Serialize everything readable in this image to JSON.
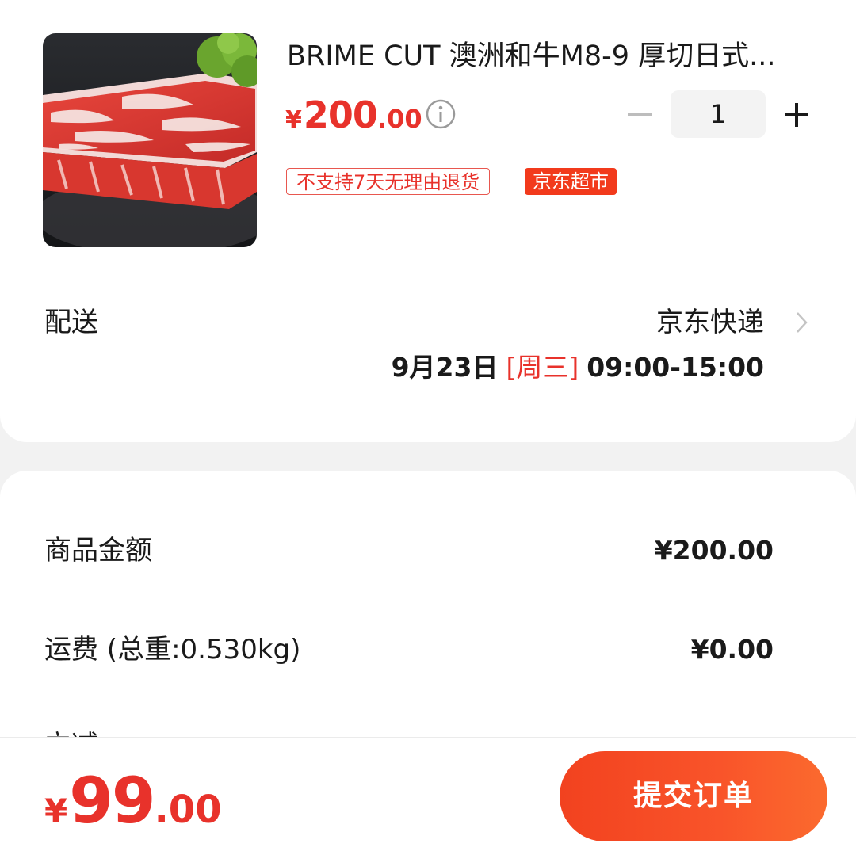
{
  "product": {
    "title": "BRIME CUT 澳洲和牛M8-9 厚切日式...",
    "image": "wagyu-steak-image",
    "price": {
      "symbol": "¥",
      "integer": "200",
      "decimal": ".00"
    },
    "quantity": "1",
    "tags": {
      "return_policy": "不支持7天无理由退货",
      "store": "京东超市"
    }
  },
  "delivery": {
    "label": "配送",
    "method": "京东快递",
    "date": "9月23日",
    "weekday": "[周三]",
    "time_range": "09:00-15:00"
  },
  "summary": {
    "goods_amount_label": "商品金额",
    "goods_amount_value": "¥200.00",
    "shipping_label": "运费 (总重:0.530kg)",
    "shipping_value": "¥0.00",
    "partial_row_label": "立减"
  },
  "bottom": {
    "total": {
      "symbol": "¥",
      "integer": "99",
      "decimal": ".00"
    },
    "submit_label": "提交订单"
  },
  "colors": {
    "accent_red": "#e8322b",
    "store_tag": "#f23a1c",
    "button_gradient_start": "#f2421f",
    "button_gradient_end": "#fb6a2e",
    "page_background": "#f2f2f2"
  },
  "icons": [
    "info-icon",
    "minus-icon",
    "plus-icon",
    "chevron-right-icon"
  ]
}
